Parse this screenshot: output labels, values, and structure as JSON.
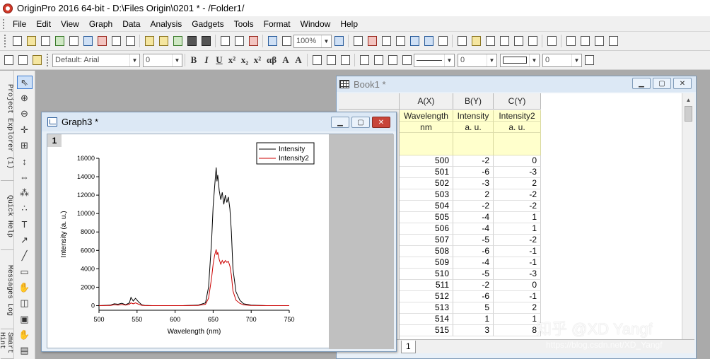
{
  "window": {
    "title": "OriginPro 2016 64-bit - D:\\Files Origin\\0201 * - /Folder1/"
  },
  "menu": [
    "File",
    "Edit",
    "View",
    "Graph",
    "Data",
    "Analysis",
    "Gadgets",
    "Tools",
    "Format",
    "Window",
    "Help"
  ],
  "toolbar": {
    "zoom": "100%",
    "font_name": "Default: Arial",
    "font_size": "0",
    "line_width": "0",
    "border_width": "0"
  },
  "left_tabs": [
    "Project Explorer (1)",
    "Quick Help",
    "Messages Log",
    "Smart Hint"
  ],
  "book": {
    "title": "Book1 *",
    "columns": [
      {
        "name": "A(X)",
        "long_name": "Wavelength",
        "units": "nm"
      },
      {
        "name": "B(Y)",
        "long_name": "Intensity",
        "units": "a. u."
      },
      {
        "name": "C(Y)",
        "long_name": "Intensity2",
        "units": "a. u."
      }
    ],
    "rows": [
      [
        "500",
        "-2",
        "0"
      ],
      [
        "501",
        "-6",
        "-3"
      ],
      [
        "502",
        "-3",
        "2"
      ],
      [
        "503",
        "2",
        "-2"
      ],
      [
        "504",
        "-2",
        "-2"
      ],
      [
        "505",
        "-4",
        "1"
      ],
      [
        "506",
        "-4",
        "1"
      ],
      [
        "507",
        "-5",
        "-2"
      ],
      [
        "508",
        "-6",
        "-1"
      ],
      [
        "509",
        "-4",
        "-1"
      ],
      [
        "510",
        "-5",
        "-3"
      ],
      [
        "511",
        "-2",
        "0"
      ],
      [
        "512",
        "-6",
        "-1"
      ],
      [
        "513",
        "5",
        "2"
      ],
      [
        "514",
        "1",
        "1"
      ],
      [
        "515",
        "3",
        "8"
      ]
    ],
    "sheet_tab": "1"
  },
  "graph": {
    "title": "Graph3 *",
    "layer": "1"
  },
  "chart_data": {
    "type": "line",
    "title": "",
    "xlabel": "Wavelength (nm)",
    "ylabel": "Intensity (a. u.)",
    "xlim": [
      500,
      750
    ],
    "ylim": [
      -500,
      16000
    ],
    "xticks": [
      500,
      550,
      600,
      650,
      700,
      750
    ],
    "yticks": [
      0,
      2000,
      4000,
      6000,
      8000,
      10000,
      12000,
      14000,
      16000
    ],
    "legend": "top-right",
    "grid": false,
    "series": [
      {
        "name": "Intensity",
        "color": "#000000",
        "x": [
          500,
          515,
          520,
          525,
          530,
          535,
          540,
          542,
          545,
          548,
          552,
          556,
          560,
          570,
          590,
          610,
          630,
          640,
          644,
          648,
          650,
          652,
          654,
          655,
          656,
          658,
          660,
          662,
          664,
          666,
          668,
          670,
          672,
          674,
          676,
          680,
          685,
          690,
          700,
          720,
          750
        ],
        "y": [
          0,
          50,
          200,
          150,
          250,
          100,
          300,
          900,
          500,
          800,
          400,
          100,
          30,
          0,
          0,
          0,
          50,
          300,
          2000,
          7000,
          10800,
          13000,
          15000,
          13500,
          14200,
          12500,
          11500,
          12300,
          11000,
          12000,
          11200,
          11800,
          10500,
          8000,
          4000,
          1500,
          600,
          200,
          50,
          0,
          0
        ]
      },
      {
        "name": "Intensity2",
        "color": "#cc0000",
        "x": [
          500,
          515,
          520,
          525,
          530,
          535,
          540,
          542,
          545,
          548,
          552,
          556,
          560,
          570,
          590,
          610,
          630,
          640,
          644,
          648,
          650,
          652,
          654,
          655,
          656,
          658,
          660,
          662,
          664,
          666,
          668,
          670,
          672,
          674,
          676,
          680,
          685,
          690,
          700,
          720,
          750
        ],
        "y": [
          0,
          20,
          100,
          60,
          120,
          50,
          150,
          300,
          200,
          300,
          150,
          40,
          10,
          0,
          0,
          0,
          20,
          150,
          800,
          3000,
          4500,
          5500,
          6100,
          5500,
          5800,
          5000,
          4500,
          4900,
          4600,
          4900,
          4700,
          4800,
          4300,
          3300,
          1600,
          600,
          250,
          80,
          20,
          0,
          0
        ]
      }
    ]
  },
  "watermark": {
    "text": "知乎 @XD Yangf",
    "url": "https://blog.csdn.net/XD_Yangf"
  }
}
